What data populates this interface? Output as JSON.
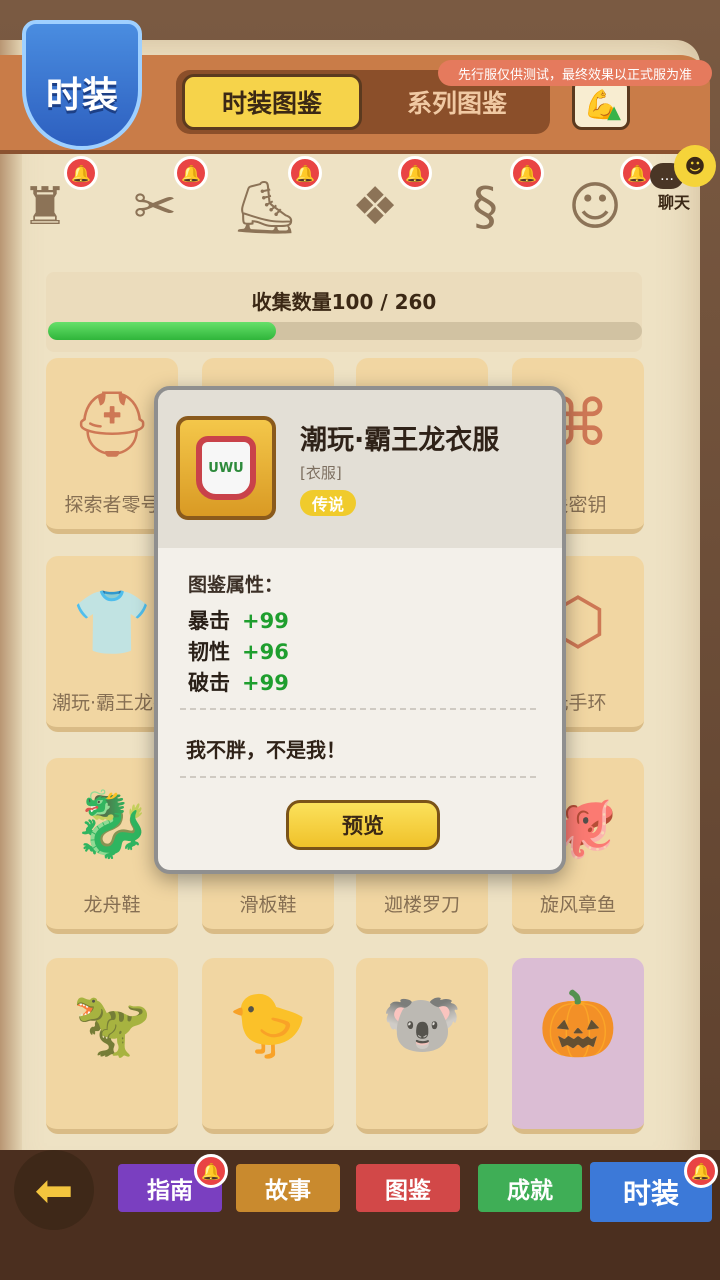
{
  "header": {
    "title": "时装",
    "tabs": [
      {
        "label": "时装图鉴",
        "active": true
      },
      {
        "label": "系列图鉴",
        "active": false
      }
    ],
    "notice": "先行服仅供测试，最终效果以正式服为准",
    "upgrade_icon": "flex-arm-upgrade-icon"
  },
  "chat": {
    "label": "聊天",
    "icon": "chat-face-icon"
  },
  "categories": [
    {
      "icon": "hat-icon",
      "glyph": "♜"
    },
    {
      "icon": "top-icon",
      "glyph": "✂"
    },
    {
      "icon": "boot-icon",
      "glyph": "⛸"
    },
    {
      "icon": "glasses-icon",
      "glyph": "❖"
    },
    {
      "icon": "scarf-icon",
      "glyph": "§"
    },
    {
      "icon": "pet-icon",
      "glyph": "☺"
    }
  ],
  "collection": {
    "label": "收集数量100 / 260",
    "current": 100,
    "total": 260
  },
  "grid": [
    {
      "name": "探索者零号",
      "glyph": "⛑"
    },
    {
      "name": "",
      "glyph": ""
    },
    {
      "name": "",
      "glyph": ""
    },
    {
      "name": "关密钥",
      "glyph": "⌘"
    },
    {
      "name": "潮玩·霸王龙衣",
      "glyph": "👕"
    },
    {
      "name": "",
      "glyph": ""
    },
    {
      "name": "",
      "glyph": ""
    },
    {
      "name": "元手环",
      "glyph": "⬡"
    },
    {
      "name": "龙舟鞋",
      "glyph": "🐉"
    },
    {
      "name": "滑板鞋",
      "glyph": ""
    },
    {
      "name": "迦楼罗刀",
      "glyph": ""
    },
    {
      "name": "旋风章鱼",
      "glyph": "🐙"
    },
    {
      "name": "",
      "glyph": "🦖"
    },
    {
      "name": "",
      "glyph": "🐤"
    },
    {
      "name": "",
      "glyph": "🐨"
    },
    {
      "name": "",
      "glyph": "🎃"
    }
  ],
  "popup": {
    "title": "潮玩·霸王龙衣服",
    "type": "[衣服]",
    "rarity": "传说",
    "rarity_color": "#f0cb2c",
    "icon_text": "UWU",
    "attr_title": "图鉴属性：",
    "attrs": [
      {
        "name": "暴击",
        "value": "+99"
      },
      {
        "name": "韧性",
        "value": "+96"
      },
      {
        "name": "破击",
        "value": "+99"
      }
    ],
    "quote": "我不胖，不是我！",
    "button": "预览"
  },
  "bottom_tabs": [
    {
      "label": "指南",
      "color": "#7a3fc0",
      "badge": true
    },
    {
      "label": "故事",
      "color": "#c98a2e",
      "badge": false
    },
    {
      "label": "图鉴",
      "color": "#d24848",
      "badge": false
    },
    {
      "label": "成就",
      "color": "#3fae56",
      "badge": false
    },
    {
      "label": "时装",
      "color": "#3c79d8",
      "badge": true,
      "active": true
    }
  ]
}
